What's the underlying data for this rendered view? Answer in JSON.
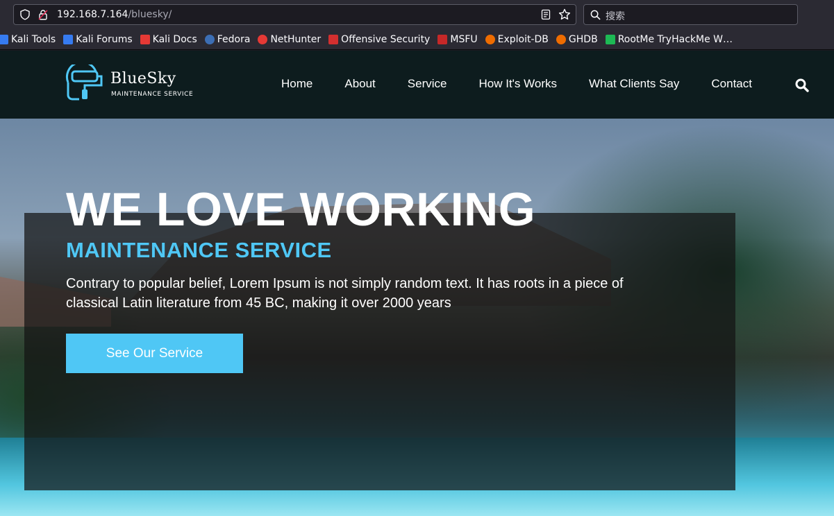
{
  "browser": {
    "url_host": "192.168.7.164",
    "url_path": "/bluesky/",
    "search_placeholder": "搜索",
    "bookmarks": [
      {
        "label": "Kali Tools",
        "icon": "kali-dragon-icon",
        "color": "#367bf0"
      },
      {
        "label": "Kali Forums",
        "icon": "kali-dragon-icon",
        "color": "#367bf0"
      },
      {
        "label": "Kali Docs",
        "icon": "kali-docs-icon",
        "color": "#e53935"
      },
      {
        "label": "Fedora",
        "icon": "fedora-icon",
        "color": "#3c6eb4"
      },
      {
        "label": "NetHunter",
        "icon": "nethunter-icon",
        "color": "#e53935"
      },
      {
        "label": "Offensive Security",
        "icon": "offsec-icon",
        "color": "#d32f2f"
      },
      {
        "label": "MSFU",
        "icon": "msfu-icon",
        "color": "#c62828"
      },
      {
        "label": "Exploit-DB",
        "icon": "exploitdb-icon",
        "color": "#ef6c00"
      },
      {
        "label": "GHDB",
        "icon": "ghdb-icon",
        "color": "#ef6c00"
      },
      {
        "label": "RootMe TryHackMe W…",
        "icon": "tryhackme-icon",
        "color": "#1db954"
      }
    ]
  },
  "site": {
    "logo": {
      "title": "BlueSky",
      "subtitle": "MAINTENANCE SERVICE",
      "accent": "#4fc7f5"
    },
    "nav": [
      {
        "label": "Home"
      },
      {
        "label": "About"
      },
      {
        "label": "Service"
      },
      {
        "label": "How It's Works"
      },
      {
        "label": "What Clients Say"
      },
      {
        "label": "Contact"
      }
    ],
    "hero": {
      "heading": "WE LOVE WORKING",
      "subheading": "MAINTENANCE SERVICE",
      "text": "Contrary to popular belief, Lorem Ipsum is not simply random text. It has roots in a piece of classical Latin literature from 45 BC, making it over 2000 years",
      "button": "See Our Service"
    }
  }
}
